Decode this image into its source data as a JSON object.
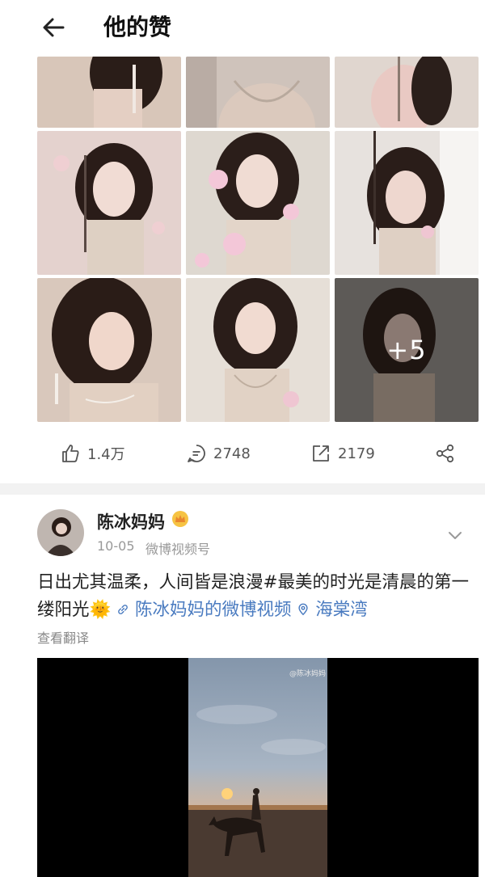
{
  "header": {
    "title": "他的赞",
    "back_icon": "arrow-left-icon"
  },
  "photo_grid": {
    "more_count": "+5",
    "tile_count": 9
  },
  "actions": {
    "likes": "1.4万",
    "comments": "2748",
    "reposts": "2179"
  },
  "post": {
    "author": "陈冰妈妈",
    "badge_icon": "crown-icon",
    "date": "10-05",
    "source": "微博视频号",
    "text_main": "日出尤其温柔，人间皆是浪漫#最美的时光是清晨的第一缕阳光",
    "emoji": "🌞",
    "video_link": "陈冰妈妈的微博视频",
    "location": "海棠湾",
    "translate": "查看翻译",
    "video_watermark": "@陈冰妈妈"
  },
  "colors": {
    "link": "#4a7bc0",
    "muted": "#999999",
    "divider": "#f2f2f2"
  }
}
